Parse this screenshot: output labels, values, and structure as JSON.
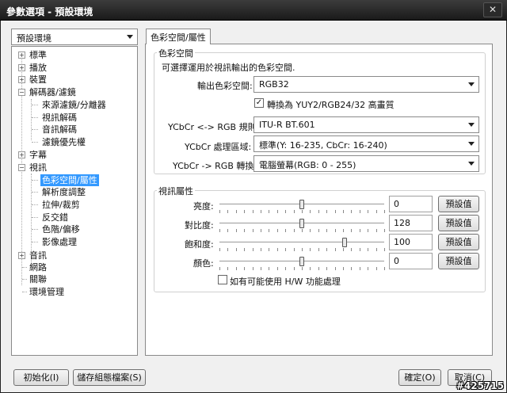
{
  "window": {
    "title": "參數選項 - 預設環境",
    "close_glyph": "✕"
  },
  "profile": {
    "selected": "預設環境"
  },
  "tree": {
    "items": [
      {
        "label": "標準",
        "expander": "+"
      },
      {
        "label": "播放",
        "expander": "+"
      },
      {
        "label": "裝置",
        "expander": "+"
      },
      {
        "label": "解碼器/濾鏡",
        "expander": "−"
      },
      {
        "label": "來源濾鏡/分離器"
      },
      {
        "label": "視訊解碼"
      },
      {
        "label": "音訊解碼"
      },
      {
        "label": "濾鏡優先權"
      },
      {
        "label": "字幕",
        "expander": "+"
      },
      {
        "label": "視訊",
        "expander": "−"
      },
      {
        "label": "色彩空間/屬性",
        "selected": true
      },
      {
        "label": "解析度調整"
      },
      {
        "label": "拉伸/裁剪"
      },
      {
        "label": "反交錯"
      },
      {
        "label": "色階/偏移"
      },
      {
        "label": "影像處理"
      },
      {
        "label": "音訊",
        "expander": "+"
      },
      {
        "label": "網路"
      },
      {
        "label": "關聯"
      },
      {
        "label": "環境管理"
      }
    ]
  },
  "tab": {
    "label": "色彩空間/屬性"
  },
  "colorspace": {
    "group_label": "色彩空間",
    "description": "可選擇運用於視訊輸出的色彩空間.",
    "output_label": "輸出色彩空間:",
    "output_value": "RGB32",
    "convert_label": "轉換為 YUY2/RGB24/32 高畫質",
    "convert_checked": "✓",
    "rule_label": "YCbCr <-> RGB 規則:",
    "rule_value": "ITU-R BT.601",
    "range_label": "YCbCr 處理區域:",
    "range_value": "標準(Y: 16-235, CbCr: 16-240)",
    "rgbconv_label": "YCbCr -> RGB 轉換:",
    "rgbconv_value": "電腦螢幕(RGB: 0 - 255)"
  },
  "video": {
    "group_label": "視訊屬性",
    "rows": [
      {
        "label": "亮度:",
        "value": "0",
        "level": 0.5
      },
      {
        "label": "對比度:",
        "value": "128",
        "level": 0.5
      },
      {
        "label": "飽和度:",
        "value": "100",
        "level": 0.76
      },
      {
        "label": "顏色:",
        "value": "0",
        "level": 0.5
      }
    ],
    "default_label": "預設值",
    "hw_label": "如有可能使用 H/W 功能處理"
  },
  "footer": {
    "init_label": "初始化(I)",
    "save_label": "儲存組態檔案(S)",
    "ok_label": "確定(O)",
    "cancel_label": "取消(C)"
  },
  "watermark": "#425715"
}
